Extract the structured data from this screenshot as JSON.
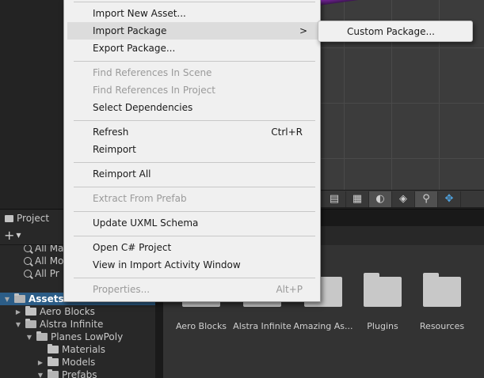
{
  "context_menu": {
    "items": {
      "import_new_asset": "Import New Asset...",
      "import_package": "Import Package",
      "export_package": "Export Package...",
      "find_refs_scene": "Find References In Scene",
      "find_refs_project": "Find References In Project",
      "select_dependencies": "Select Dependencies",
      "refresh": "Refresh",
      "refresh_shortcut": "Ctrl+R",
      "reimport": "Reimport",
      "reimport_all": "Reimport All",
      "extract_from_prefab": "Extract From Prefab",
      "update_uxml_schema": "Update UXML Schema",
      "open_csharp_project": "Open C# Project",
      "view_import_activity": "View in Import Activity Window",
      "properties": "Properties...",
      "properties_shortcut": "Alt+P",
      "submenu_arrow": ">"
    }
  },
  "submenu": {
    "custom_package": "Custom Package..."
  },
  "project_panel": {
    "tab_label": "Project",
    "add_button": "+",
    "tree": {
      "favorites": [
        "All Ma",
        "All Mo",
        "All Pr"
      ],
      "assets": "Assets",
      "aero_blocks": "Aero Blocks",
      "alstra_infinite": "Alstra Infinite",
      "planes_lowpoly": "Planes LowPoly",
      "materials": "Materials",
      "models": "Models",
      "prefabs": "Prefabs"
    },
    "assets_grid": [
      "Aero Blocks",
      "Alstra Infinite",
      "Amazing As...",
      "Plugins",
      "Resources"
    ]
  },
  "scene_toolbar": {
    "icons": [
      "layers-icon",
      "grid-icon",
      "render-mode-icon",
      "gizmos-icon",
      "search-icon",
      "orientation-icon"
    ]
  },
  "colors": {
    "menu_bg": "#f0f0f0",
    "selection": "#2c5d87",
    "beam": "#a12ed0"
  }
}
